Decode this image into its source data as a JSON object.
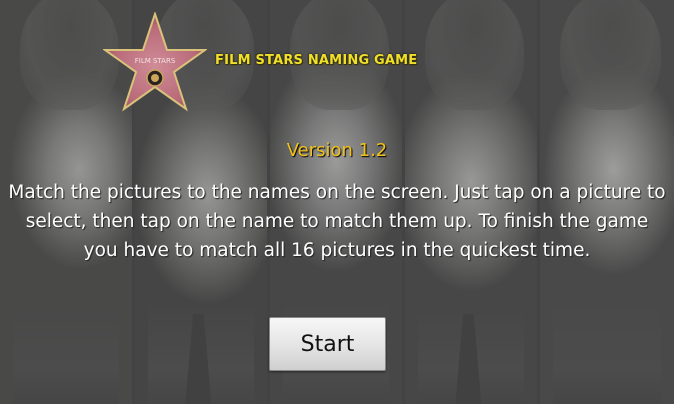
{
  "logo": {
    "label": "FILM STARS",
    "star_color": "#b86a78"
  },
  "header": {
    "title": "FILM STARS NAMING GAME",
    "title_color": "#f0e02a"
  },
  "version": {
    "text": "Version 1.2",
    "color": "#f2c21a"
  },
  "instructions": {
    "text": "Match the pictures to the names on the screen. Just tap on a picture to select, then tap on the name to match them up. To finish the game you have to match all 16 pictures in the quickest time."
  },
  "start_button": {
    "label": "Start"
  },
  "background": {
    "description_icons": [
      "portrait-photo",
      "portrait-photo",
      "portrait-photo",
      "portrait-photo",
      "portrait-photo"
    ]
  }
}
